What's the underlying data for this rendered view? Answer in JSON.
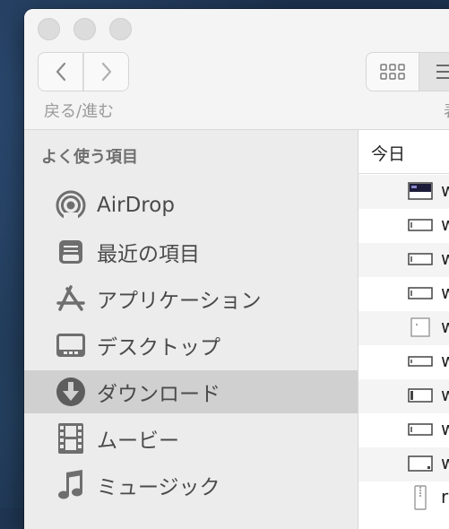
{
  "toolbar": {
    "nav_label": "戻る/進む",
    "view_label": "表"
  },
  "sidebar": {
    "heading": "よく使う項目",
    "items": [
      {
        "label": "AirDrop",
        "icon": "airdrop-icon"
      },
      {
        "label": "最近の項目",
        "icon": "recents-icon"
      },
      {
        "label": "アプリケーション",
        "icon": "applications-icon"
      },
      {
        "label": "デスクトップ",
        "icon": "desktop-icon"
      },
      {
        "label": "ダウンロード",
        "icon": "downloads-icon",
        "selected": true
      },
      {
        "label": "ムービー",
        "icon": "movies-icon"
      },
      {
        "label": "ミュージック",
        "icon": "music-icon"
      }
    ]
  },
  "list": {
    "group_header": "今日",
    "rows": [
      {
        "name": "w",
        "icon": "screenshot-dark-icon"
      },
      {
        "name": "w",
        "icon": "screenshot-icon"
      },
      {
        "name": "w",
        "icon": "screenshot-icon"
      },
      {
        "name": "w",
        "icon": "screenshot-icon"
      },
      {
        "name": "w",
        "icon": "screenshot-blank-icon"
      },
      {
        "name": "w",
        "icon": "screenshot-icon"
      },
      {
        "name": "w",
        "icon": "screenshot-icon"
      },
      {
        "name": "w",
        "icon": "screenshot-icon"
      },
      {
        "name": "w",
        "icon": "screenshot-icon"
      },
      {
        "name": "r",
        "icon": "zip-file-icon"
      }
    ]
  }
}
